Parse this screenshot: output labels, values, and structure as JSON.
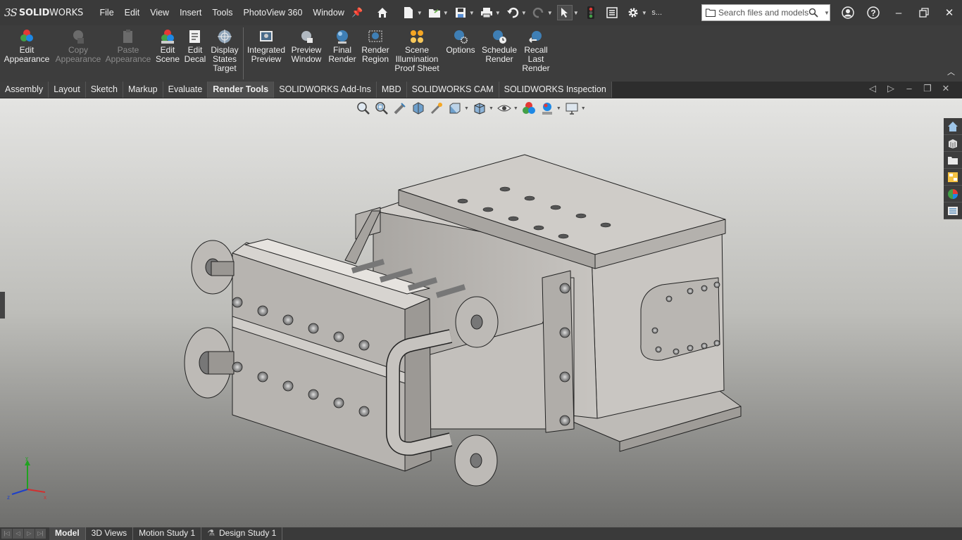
{
  "app": {
    "logo_ds": "3S",
    "logo_name_bold": "SOLID",
    "logo_name_rest": "WORKS"
  },
  "menu": [
    "File",
    "Edit",
    "View",
    "Insert",
    "Tools",
    "PhotoView 360",
    "Window"
  ],
  "titlebar_icons": [
    "home-icon",
    "new-document-icon",
    "open-folder-icon",
    "save-icon",
    "print-icon",
    "undo-icon",
    "redo-icon",
    "select-cursor-icon",
    "rebuild-traffic-light-icon",
    "file-properties-icon",
    "options-gear-icon"
  ],
  "quick_label": "s...",
  "search": {
    "placeholder": "Search files and models"
  },
  "ribbon": {
    "buttons": [
      {
        "label": "Edit\nAppearance",
        "icon": "edit-appearance-icon",
        "enabled": true
      },
      {
        "label": "Copy\nAppearance",
        "icon": "copy-appearance-icon",
        "enabled": false
      },
      {
        "label": "Paste\nAppearance",
        "icon": "paste-appearance-icon",
        "enabled": false
      },
      {
        "label": "Edit\nScene",
        "icon": "edit-scene-icon",
        "enabled": true
      },
      {
        "label": "Edit\nDecal",
        "icon": "edit-decal-icon",
        "enabled": true
      },
      {
        "label": "Display\nStates\nTarget",
        "icon": "display-states-icon",
        "enabled": true
      },
      {
        "label": "Integrated\nPreview",
        "icon": "integrated-preview-icon",
        "enabled": true
      },
      {
        "label": "Preview\nWindow",
        "icon": "preview-window-icon",
        "enabled": true
      },
      {
        "label": "Final\nRender",
        "icon": "final-render-icon",
        "enabled": true
      },
      {
        "label": "Render\nRegion",
        "icon": "render-region-icon",
        "enabled": true
      },
      {
        "label": "Scene\nIllumination\nProof Sheet",
        "icon": "scene-illumination-icon",
        "enabled": true
      },
      {
        "label": "Options",
        "icon": "render-options-icon",
        "enabled": true
      },
      {
        "label": "Schedule\nRender",
        "icon": "schedule-render-icon",
        "enabled": true
      },
      {
        "label": "Recall\nLast\nRender",
        "icon": "recall-last-render-icon",
        "enabled": true
      }
    ]
  },
  "tabs": [
    "Assembly",
    "Layout",
    "Sketch",
    "Markup",
    "Evaluate",
    "Render Tools",
    "SOLIDWORKS Add-Ins",
    "MBD",
    "SOLIDWORKS CAM",
    "SOLIDWORKS Inspection"
  ],
  "active_tab": "Render Tools",
  "heads_up_toolbar": [
    "zoom-to-fit-icon",
    "zoom-to-area-icon",
    "previous-view-icon",
    "section-view-icon",
    "dynamic-annotation-icon",
    "view-orientation-icon",
    "display-style-icon",
    "hide-show-items-icon",
    "edit-appearance-icon",
    "apply-scene-icon",
    "view-settings-icon"
  ],
  "task_pane": [
    "solidworks-resources-icon",
    "design-library-icon",
    "file-explorer-icon",
    "view-palette-icon",
    "appearances-scenes-icon",
    "custom-properties-icon"
  ],
  "triad": {
    "x": "x",
    "y": "y",
    "z": "z"
  },
  "bottom_tabs": [
    "Model",
    "3D Views",
    "Motion Study 1",
    "Design Study 1"
  ],
  "active_bottom_tab": "Model",
  "colors": {
    "accent": "#3d3d3d",
    "viewport_top": "#e4e4e2",
    "viewport_bottom": "#6e6e6c",
    "model_gray": "#c2bfbb"
  }
}
